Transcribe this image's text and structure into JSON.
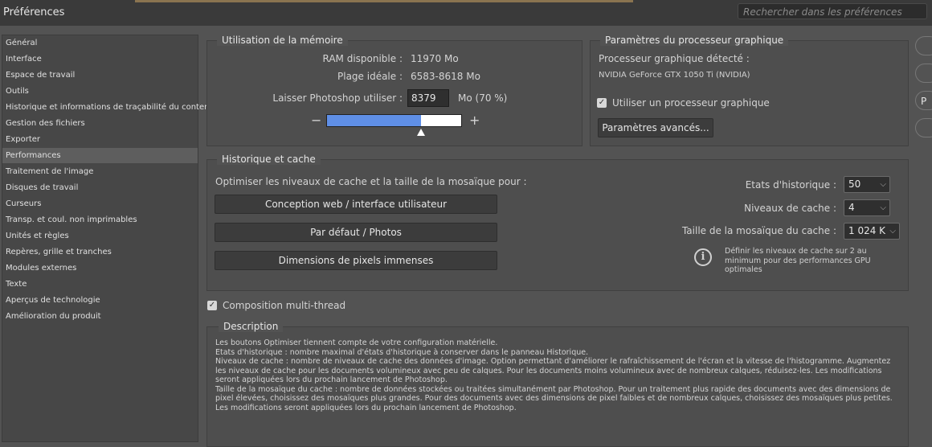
{
  "window": {
    "title": "Préférences"
  },
  "search": {
    "placeholder": "Rechercher dans les préférences"
  },
  "sidebar": {
    "items": [
      "Général",
      "Interface",
      "Espace de travail",
      "Outils",
      "Historique et informations de traçabilité du contenu",
      "Gestion des fichiers",
      "Exporter",
      "Performances",
      "Traitement de l'image",
      "Disques de travail",
      "Curseurs",
      "Transp. et coul. non imprimables",
      "Unités et règles",
      "Repères, grille et tranches",
      "Modules externes",
      "Texte",
      "Aperçus de technologie",
      "Amélioration du produit"
    ],
    "selected": "Performances"
  },
  "memory": {
    "title": "Utilisation de la mémoire",
    "ram_label": "RAM disponible :",
    "ram_value": "11970 Mo",
    "range_label": "Plage idéale :",
    "range_value": "6583-8618 Mo",
    "let_label": "Laisser Photoshop utiliser :",
    "let_value": "8379",
    "let_unit": "Mo (70 %)",
    "minus": "−",
    "plus": "+",
    "slider_fraction": 0.7
  },
  "gpu": {
    "title": "Paramètres du processeur graphique",
    "detected_label": "Processeur graphique détecté :",
    "detected_value": "NVIDIA GeForce GTX 1050 Ti (NVIDIA)",
    "use_gpu_label": "Utiliser un processeur graphique",
    "use_gpu_checked": true,
    "advanced_button": "Paramètres avancés..."
  },
  "cache": {
    "title": "Historique et cache",
    "optimize_label": "Optimiser les niveaux de cache et la taille de la mosaïque pour :",
    "buttons": [
      "Conception web / interface utilisateur",
      "Par défaut / Photos",
      "Dimensions de pixels immenses"
    ],
    "history_label": "Etats d'historique :",
    "history_value": "50",
    "levels_label": "Niveaux de cache :",
    "levels_value": "4",
    "tile_label": "Taille de la mosaïque du cache :",
    "tile_value": "1 024 K",
    "info_lines": [
      "Définir les niveaux de cache sur 2 au",
      "minimum pour des performances GPU",
      "optimales"
    ]
  },
  "multithread": {
    "label": "Composition multi-thread",
    "checked": true
  },
  "description": {
    "title": "Description",
    "lines": [
      "Les boutons Optimiser tiennent compte de votre configuration matérielle.",
      "Etats d'historique : nombre maximal d'états d'historique à conserver dans le panneau Historique.",
      "Niveaux de cache : nombre de niveaux de cache des données d'image. Option permettant d'améliorer le rafraîchissement de l'écran et la vitesse de l'histogramme. Augmentez les niveaux de cache pour les documents volumineux avec peu de calques. Pour les documents moins volumineux avec de nombreux calques, réduisez-les. Les modifications seront appliquées lors du prochain lancement de Photoshop.",
      "Taille de la mosaïque du cache : nombre de données stockées ou traitées simultanément par Photoshop. Pour un traitement plus rapide des documents avec des dimensions de pixel élevées, choisissez des mosaïques plus grandes. Pour des documents avec des dimensions de pixel faibles et de nombreux calques, choisissez des mosaïques plus petites. Les modifications seront appliquées lors du prochain lancement de Photoshop."
    ]
  },
  "right_buttons": [
    "",
    "",
    "P",
    ""
  ]
}
